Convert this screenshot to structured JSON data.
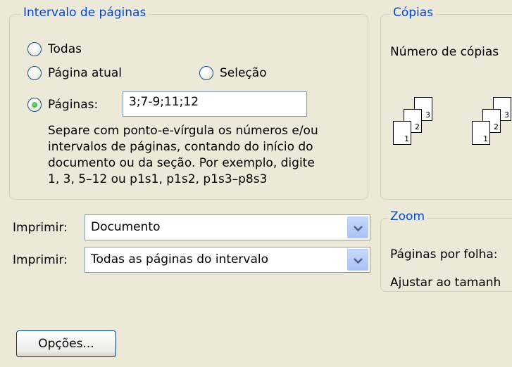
{
  "page_range": {
    "title": "Intervalo de páginas",
    "options": {
      "all": {
        "label": "Todas",
        "selected": false
      },
      "current": {
        "label": "Página atual",
        "selected": false
      },
      "selection": {
        "label": "Seleção",
        "selected": false
      },
      "pages": {
        "label": "Páginas:",
        "selected": true
      }
    },
    "pages_value": "3;7-9;11;12",
    "help": [
      "Separe com ponto-e-vírgula os números e/ou",
      "intervalos de páginas, contando do início do",
      "documento ou da seção. Por exemplo, digite",
      "1, 3, 5–12 ou p1s1, p1s2, p1s3–p8s3"
    ]
  },
  "copies": {
    "title": "Cópias",
    "count_label": "Número de cópias",
    "stack_numbers": [
      "1",
      "2",
      "3"
    ]
  },
  "print_what": {
    "label": "Imprimir:",
    "value": "Documento"
  },
  "print_range": {
    "label": "Imprimir:",
    "value": "Todas as páginas do intervalo"
  },
  "zoom": {
    "title": "Zoom",
    "pages_per_sheet_label": "Páginas por folha:",
    "fit_label": "Ajustar ao tamanh"
  },
  "options_button": {
    "label": "Opções..."
  },
  "icons": {
    "dropdown": "chevron-down-icon",
    "collate": "collate-pages-icon"
  }
}
